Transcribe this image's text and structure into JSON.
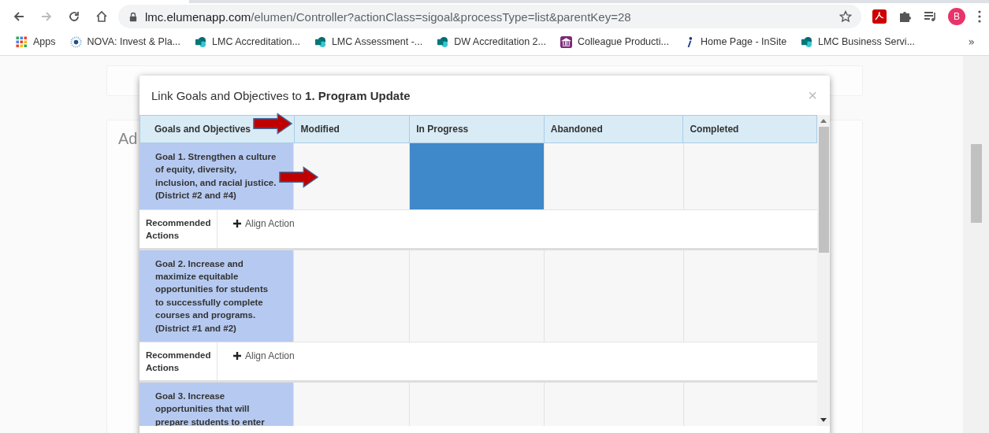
{
  "browser": {
    "url_host": "lmc.elumenapp.com",
    "url_path": "/elumen/Controller?actionClass=sigoal&processType=list&parentKey=28",
    "profile_initial": "B",
    "bookmarks": [
      {
        "label": "Apps",
        "kind": "apps"
      },
      {
        "label": "NOVA: Invest & Pla...",
        "kind": "nova"
      },
      {
        "label": "LMC Accreditation...",
        "kind": "sharepoint"
      },
      {
        "label": "LMC Assessment -...",
        "kind": "sharepoint"
      },
      {
        "label": "DW Accreditation 2...",
        "kind": "sharepoint"
      },
      {
        "label": "Colleague Producti...",
        "kind": "building"
      },
      {
        "label": "Home Page - InSite",
        "kind": "insite"
      },
      {
        "label": "LMC Business Servi...",
        "kind": "sharepoint"
      }
    ],
    "more": "»"
  },
  "background": {
    "heading": "Ad"
  },
  "modal": {
    "title": "Link Goals and Objectives to **1. Program Update**",
    "close": "×",
    "columns": [
      "Goals and Objectives",
      "Modified",
      "In Progress",
      "Abandoned",
      "Completed"
    ],
    "goals": [
      {
        "text": "Goal 1. Strengthen a culture of equity, diversity, inclusion, and racial justice. (District #2 and #4)",
        "statuses": [
          {
            "selected": false
          },
          {
            "selected": true
          },
          {
            "selected": false
          },
          {
            "selected": false
          }
        ],
        "actions_label": "Recommended Actions",
        "align_action": "Align Action"
      },
      {
        "text": "Goal 2. Increase and maximize equitable opportunities for students to successfully complete courses and programs. (District #1 and #2)",
        "statuses": [
          {
            "selected": false
          },
          {
            "selected": false
          },
          {
            "selected": false
          },
          {
            "selected": false
          }
        ],
        "actions_label": "Recommended Actions",
        "align_action": "Align Action"
      },
      {
        "text": "Goal 3. Increase opportunities that will prepare students to enter",
        "statuses": [
          {
            "selected": false
          },
          {
            "selected": false
          },
          {
            "selected": false
          },
          {
            "selected": false
          }
        ]
      }
    ]
  }
}
